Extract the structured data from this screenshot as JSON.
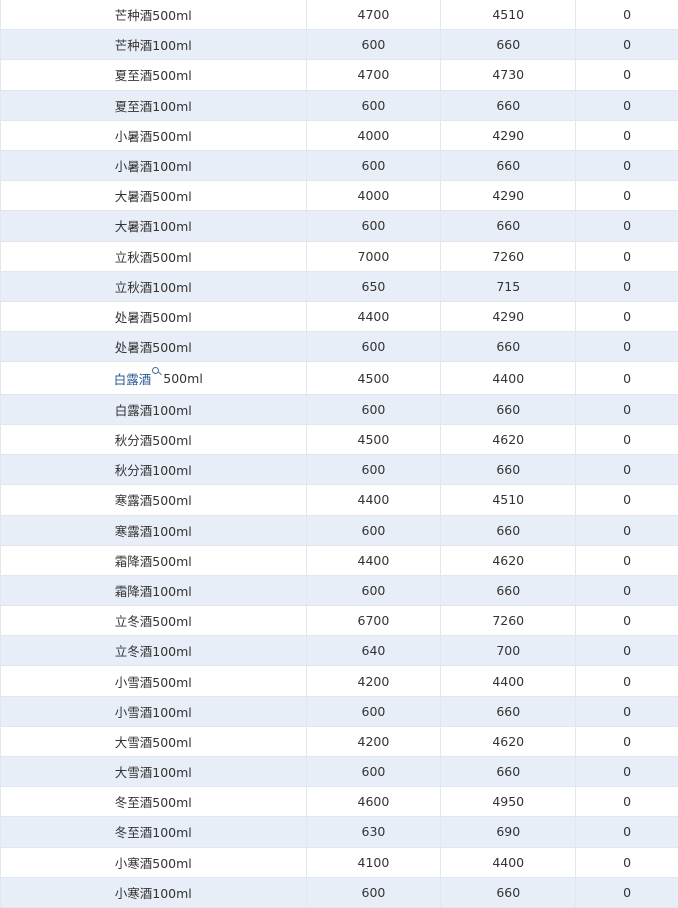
{
  "table": {
    "rows": [
      {
        "name": "芒种酒500ml",
        "a": "4700",
        "b": "4510",
        "c": "0"
      },
      {
        "name": "芒种酒100ml",
        "a": "600",
        "b": "660",
        "c": "0"
      },
      {
        "name": "夏至酒500ml",
        "a": "4700",
        "b": "4730",
        "c": "0"
      },
      {
        "name": "夏至酒100ml",
        "a": "600",
        "b": "660",
        "c": "0"
      },
      {
        "name": "小暑酒500ml",
        "a": "4000",
        "b": "4290",
        "c": "0"
      },
      {
        "name": "小暑酒100ml",
        "a": "600",
        "b": "660",
        "c": "0"
      },
      {
        "name": "大暑酒500ml",
        "a": "4000",
        "b": "4290",
        "c": "0"
      },
      {
        "name": "大暑酒100ml",
        "a": "600",
        "b": "660",
        "c": "0"
      },
      {
        "name": "立秋酒500ml",
        "a": "7000",
        "b": "7260",
        "c": "0"
      },
      {
        "name": "立秋酒100ml",
        "a": "650",
        "b": "715",
        "c": "0"
      },
      {
        "name": "处暑酒500ml",
        "a": "4400",
        "b": "4290",
        "c": "0"
      },
      {
        "name": "处暑酒500ml",
        "a": "600",
        "b": "660",
        "c": "0"
      },
      {
        "name_prefix": "白露酒",
        "name_suffix": "500ml",
        "a": "4500",
        "b": "4400",
        "c": "0"
      },
      {
        "name": "白露酒100ml",
        "a": "600",
        "b": "660",
        "c": "0"
      },
      {
        "name": "秋分酒500ml",
        "a": "4500",
        "b": "4620",
        "c": "0"
      },
      {
        "name": "秋分酒100ml",
        "a": "600",
        "b": "660",
        "c": "0"
      },
      {
        "name": "寒露酒500ml",
        "a": "4400",
        "b": "4510",
        "c": "0"
      },
      {
        "name": "寒露酒100ml",
        "a": "600",
        "b": "660",
        "c": "0"
      },
      {
        "name": "霜降酒500ml",
        "a": "4400",
        "b": "4620",
        "c": "0"
      },
      {
        "name": "霜降酒100ml",
        "a": "600",
        "b": "660",
        "c": "0"
      },
      {
        "name": "立冬酒500ml",
        "a": "6700",
        "b": "7260",
        "c": "0"
      },
      {
        "name": "立冬酒100ml",
        "a": "640",
        "b": "700",
        "c": "0"
      },
      {
        "name": "小雪酒500ml",
        "a": "4200",
        "b": "4400",
        "c": "0"
      },
      {
        "name": "小雪酒100ml",
        "a": "600",
        "b": "660",
        "c": "0"
      },
      {
        "name": "大雪酒500ml",
        "a": "4200",
        "b": "4620",
        "c": "0"
      },
      {
        "name": "大雪酒100ml",
        "a": "600",
        "b": "660",
        "c": "0"
      },
      {
        "name": "冬至酒500ml",
        "a": "4600",
        "b": "4950",
        "c": "0"
      },
      {
        "name": "冬至酒100ml",
        "a": "630",
        "b": "690",
        "c": "0"
      },
      {
        "name": "小寒酒500ml",
        "a": "4100",
        "b": "4400",
        "c": "0"
      },
      {
        "name": "小寒酒100ml",
        "a": "600",
        "b": "660",
        "c": "0"
      }
    ]
  },
  "icons": {
    "search": "magnifier-icon"
  },
  "colors": {
    "alt_row": "#e8eef7",
    "border": "#e3e6eb",
    "text": "#333333",
    "highlight": "#2b5797"
  }
}
